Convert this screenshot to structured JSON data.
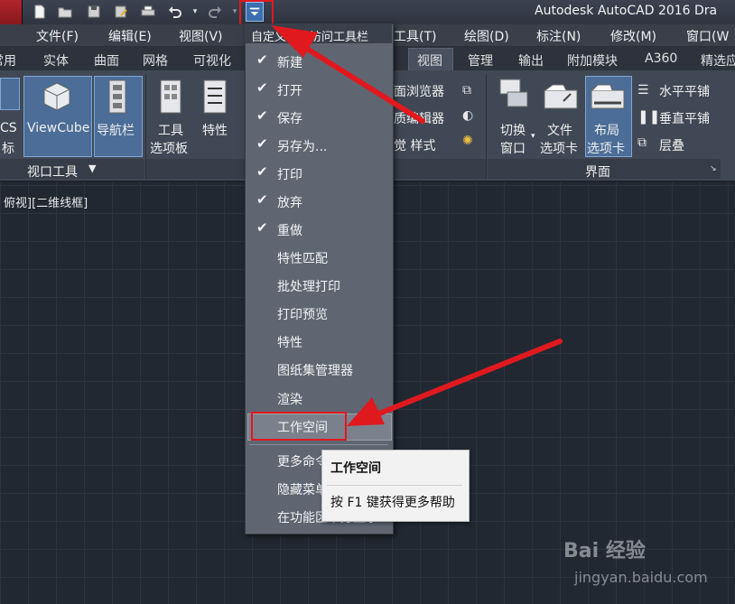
{
  "title_bar": {
    "text": "Autodesk AutoCAD 2016    Dra"
  },
  "menubar": {
    "items": [
      "文件(F)",
      "编辑(E)",
      "视图(V)",
      "工具(T)",
      "绘图(D)",
      "标注(N)",
      "修改(M)",
      "窗口(W"
    ]
  },
  "ribbon_tabs": [
    "常用",
    "实体",
    "曲面",
    "网格",
    "可视化",
    "视图",
    "管理",
    "输出",
    "附加模块",
    "A360",
    "精选应"
  ],
  "ribbon": {
    "left_clip_label_1": "CS",
    "left_clip_label_2": "标",
    "viewcube": "ViewCube",
    "nav_bar": "导航栏",
    "tool_palette_1": "工具",
    "tool_palette_2": "选项板",
    "properties": "特性",
    "panel_viewport_tools": "视口工具",
    "sheetset_fragment": "面浏览器",
    "material_fragment": "质编辑器",
    "visual_style_fragment": "觉 样式",
    "switch_window_1": "切换",
    "switch_window_2": "窗口",
    "file_tabs_1": "文件",
    "file_tabs_2": "选项卡",
    "layout_tabs_1": "布局",
    "layout_tabs_2": "选项卡",
    "tile_h": "水平平铺",
    "tile_v": "垂直平铺",
    "cascade": "层叠",
    "panel_interface": "界面",
    "accent": "#4b6d97"
  },
  "viewport_label": "俯视][二维线框]",
  "dropdown": {
    "header": "自定义快速访问工具栏",
    "items": [
      {
        "label": "新建",
        "checked": true
      },
      {
        "label": "打开",
        "checked": true
      },
      {
        "label": "保存",
        "checked": true
      },
      {
        "label": "另存为...",
        "checked": true
      },
      {
        "label": "打印",
        "checked": true
      },
      {
        "label": "放弃",
        "checked": true
      },
      {
        "label": "重做",
        "checked": true
      },
      {
        "label": "特性匹配",
        "checked": false
      },
      {
        "label": "批处理打印",
        "checked": false
      },
      {
        "label": "打印预览",
        "checked": false
      },
      {
        "label": "特性",
        "checked": false
      },
      {
        "label": "图纸集管理器",
        "checked": false
      },
      {
        "label": "渲染",
        "checked": false
      },
      {
        "label": "工作空间",
        "checked": false
      },
      {
        "label": "更多命令",
        "checked": false
      },
      {
        "label": "隐藏菜单",
        "checked": false
      },
      {
        "label": "在功能区下方显示",
        "checked": false
      }
    ]
  },
  "tooltip": {
    "title": "工作空间",
    "help": "按 F1 键获得更多帮助"
  },
  "watermark": {
    "logo": "Bai 经验",
    "url": "jingyan.baidu.com"
  },
  "annotation_color": "#e0191f"
}
